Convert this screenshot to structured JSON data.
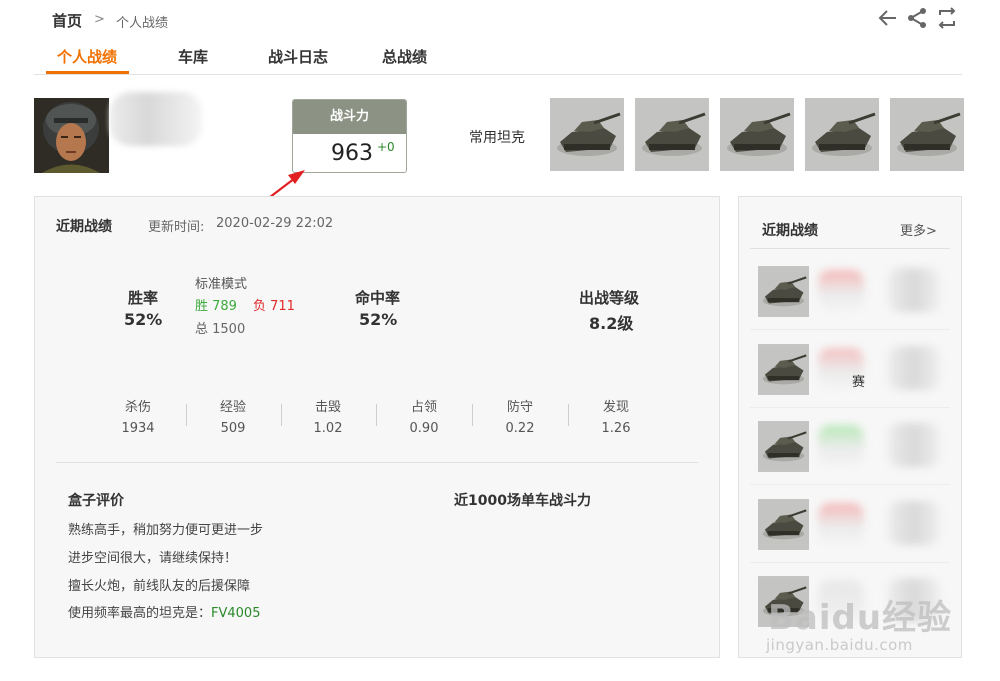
{
  "breadcrumb": {
    "home": "首页",
    "separator": ">",
    "current": "个人战绩"
  },
  "toolbar_icons": [
    "back-arrow-icon",
    "share-icon",
    "switch-icon"
  ],
  "tabs": [
    {
      "label": "个人战绩",
      "active": true
    },
    {
      "label": "车库",
      "active": false
    },
    {
      "label": "战斗日志",
      "active": false
    },
    {
      "label": "总战绩",
      "active": false
    }
  ],
  "combat_power": {
    "label": "战斗力",
    "value": "963",
    "delta": "+0"
  },
  "common_tanks": {
    "label": "常用坦克",
    "count": 5
  },
  "recent": {
    "title": "近期战绩",
    "update_label": "更新时间:",
    "update_time": "2020-02-29 22:02",
    "win_rate_label": "胜率",
    "win_rate": "52%",
    "mode": "标准模式",
    "wins": "胜 789",
    "losses": "负 711",
    "total": "总 1500",
    "hit_rate_label": "命中率",
    "hit_rate": "52%",
    "tier_label": "出战等级",
    "tier": "8.2级",
    "stats": [
      {
        "label": "杀伤",
        "value": "1934"
      },
      {
        "label": "经验",
        "value": "509"
      },
      {
        "label": "击毁",
        "value": "1.02"
      },
      {
        "label": "占领",
        "value": "0.90"
      },
      {
        "label": "防守",
        "value": "0.22"
      },
      {
        "label": "发现",
        "value": "1.26"
      }
    ]
  },
  "evaluation": {
    "title": "盒子评价",
    "lines": [
      "熟练高手，稍加努力便可更进一步",
      "进步空间很大，请继续保持！",
      "擅长火炮，前线队友的后援保障"
    ],
    "fav_prefix": "使用频率最高的坦克是：",
    "fav_tank": "FV4005"
  },
  "power_1000": {
    "title": "近1000场单车战斗力"
  },
  "sidebar": {
    "title": "近期战绩",
    "more": "更多>",
    "row2_text": "赛"
  },
  "watermark": {
    "main": "Baidu经验",
    "sub": "jingyan.baidu.com"
  },
  "colors": {
    "accent": "#f07100",
    "win": "#3caa3c",
    "loss": "#e02a2a",
    "power_header": "#8c9385",
    "fav_tank": "#2a8a2a"
  }
}
